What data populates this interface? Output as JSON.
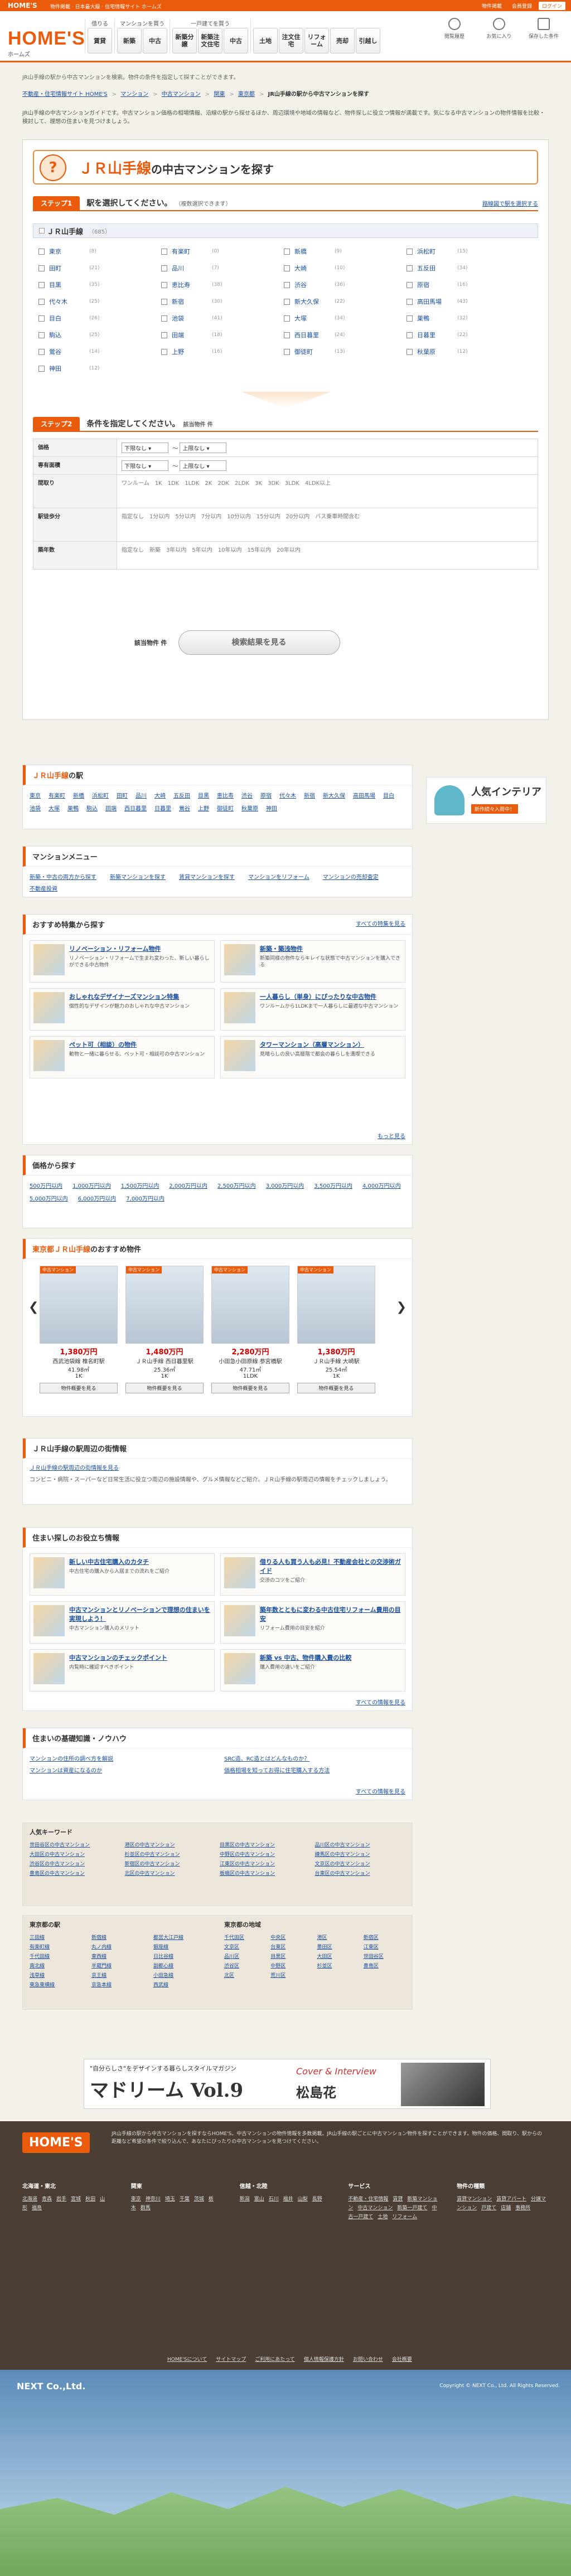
{
  "topbar": {
    "logo": "HOME'S",
    "tagline": "物件掲載 · 日本最大級 · 住宅情報サイト ホームズ",
    "right_links": [
      "物件掲載",
      "会員登録"
    ],
    "login": "ログイン"
  },
  "header": {
    "logo": "HOME'S",
    "logo_sub": "ホームズ",
    "nav_groups": [
      {
        "heading": "借りる",
        "buttons": [
          "賃貸"
        ]
      },
      {
        "heading": "マンションを買う",
        "buttons": [
          "新築",
          "中古"
        ]
      },
      {
        "heading": "一戸建てを買う",
        "buttons": [
          "新築分譲",
          "新築注文住宅",
          "中古"
        ]
      },
      {
        "heading": "",
        "buttons": [
          "土地",
          "注文住宅",
          "リフォーム",
          "売却",
          "引越し"
        ]
      }
    ],
    "icons": [
      {
        "icon": "history-icon",
        "label": "閲覧履歴"
      },
      {
        "icon": "star-icon",
        "label": "お気に入り"
      },
      {
        "icon": "document-icon",
        "label": "保存した条件"
      }
    ]
  },
  "breadcrumb_note": "JR山手線の駅から中古マンションを検索。物件の条件を指定して探すことができます。",
  "crumbs": [
    "不動産・住宅情報サイト HOME'S",
    "マンション",
    "中古マンション",
    "関東",
    "東京都",
    "JR山手線の駅から中古マンションを探す"
  ],
  "intro": "JR山手線の中古マンションガイドです。中古マンション価格の相場情報、沿線の駅から探せるほか、周辺環境や地域の情報など、物件探しに役立つ情報が満載です。気になる中古マンションの物件情報を比較・検討して、理想の住まいを見つけましょう。",
  "search": {
    "title": "ＪＲ山手線",
    "title_suffix": "の中古マンションを探す",
    "title_icon": "?",
    "step1_badge": "ステップ1",
    "step1_text": "駅を選択してください。",
    "step1_note": "（複数選択できます）",
    "step1_link": "路線図で駅を選択する",
    "line_name": "ＪＲ山手線",
    "line_count": "（685）",
    "stations": [
      {
        "name": "東京",
        "count": "(8)"
      },
      {
        "name": "有楽町",
        "count": "(0)"
      },
      {
        "name": "新橋",
        "count": "(9)"
      },
      {
        "name": "浜松町",
        "count": "(15)"
      },
      {
        "name": "田町",
        "count": "(21)"
      },
      {
        "name": "品川",
        "count": "(7)"
      },
      {
        "name": "大崎",
        "count": "(10)"
      },
      {
        "name": "五反田",
        "count": "(34)"
      },
      {
        "name": "目黒",
        "count": "(35)"
      },
      {
        "name": "恵比寿",
        "count": "(38)"
      },
      {
        "name": "渋谷",
        "count": "(36)"
      },
      {
        "name": "原宿",
        "count": "(16)"
      },
      {
        "name": "代々木",
        "count": "(25)"
      },
      {
        "name": "新宿",
        "count": "(30)"
      },
      {
        "name": "新大久保",
        "count": "(22)"
      },
      {
        "name": "高田馬場",
        "count": "(43)"
      },
      {
        "name": "目白",
        "count": "(26)"
      },
      {
        "name": "池袋",
        "count": "(41)"
      },
      {
        "name": "大塚",
        "count": "(34)"
      },
      {
        "name": "巣鴨",
        "count": "(32)"
      },
      {
        "name": "駒込",
        "count": "(25)"
      },
      {
        "name": "田端",
        "count": "(18)"
      },
      {
        "name": "西日暮里",
        "count": "(24)"
      },
      {
        "name": "日暮里",
        "count": "(22)"
      },
      {
        "name": "鶯谷",
        "count": "(14)"
      },
      {
        "name": "上野",
        "count": "(16)"
      },
      {
        "name": "御徒町",
        "count": "(13)"
      },
      {
        "name": "秋葉原",
        "count": "(12)"
      },
      {
        "name": "神田",
        "count": "(12)"
      }
    ],
    "step2_badge": "ステップ2",
    "step2_text": "条件を指定してください。",
    "step2_count_label": "該当物件",
    "step2_count_unit": "件",
    "conditions": [
      {
        "label": "価格",
        "content": "下限なし ～ 上限なし"
      },
      {
        "label": "専有面積",
        "content": "下限なし ～ 上限なし　※「以上」は「未満」と同じです"
      },
      {
        "label": "間取り",
        "content": "ワンルーム　1K　1DK　1LDK　2K　2DK　2LDK　3K　3DK　3LDK　4LDK以上"
      },
      {
        "label": "駅徒歩分",
        "content": "指定なし　1分以内　5分以内　7分以内　10分以内　15分以内　20分以内　バス乗車時間含む"
      },
      {
        "label": "築年数",
        "content": "指定なし　新築　3年以内　5年以内　10年以内　15年以内　20年以内"
      }
    ],
    "result_label": "該当物件",
    "result_unit": "件",
    "result_button": "検索結果を見る"
  },
  "eki": {
    "title_red": "ＪＲ山手線",
    "title_rest": "の駅",
    "stations": [
      "東京",
      "有楽町",
      "新橋",
      "浜松町",
      "田町",
      "品川",
      "大崎",
      "五反田",
      "目黒",
      "恵比寿",
      "渋谷",
      "原宿",
      "代々木",
      "新宿",
      "新大久保",
      "高田馬場",
      "目白",
      "池袋",
      "大塚",
      "巣鴨",
      "駒込",
      "田端",
      "西日暮里",
      "日暮里",
      "鶯谷",
      "上野",
      "御徒町",
      "秋葉原",
      "神田"
    ]
  },
  "menu": {
    "title": "マンションメニュー",
    "links": [
      "新築・中古の両方から探す",
      "新築マンションを探す",
      "賃貸マンションを探す",
      "マンションをリフォーム",
      "マンションの売却査定",
      "不動産投資"
    ]
  },
  "features": {
    "title": "おすすめ特集から探す",
    "more": "すべての特集を見る",
    "items": [
      {
        "title": "リノベーション・リフォーム物件",
        "desc": "リノベーション・リフォームで生まれ変わった、新しい暮らしができる中古物件"
      },
      {
        "title": "新築・築浅物件",
        "desc": "新築同様の物件ならキレイな状態で中古マンションを購入できる"
      },
      {
        "title": "おしゃれなデザイナーズマンション特集",
        "desc": "個性的なデザインが魅力のおしゃれな中古マンション"
      },
      {
        "title": "一人暮らし（単身）にぴったりな中古物件",
        "desc": "ワンルームから1LDKまで一人暮らしに最適な中古マンション"
      },
      {
        "title": "ペット可（相談）の物件",
        "desc": "動物と一緒に暮らせる、ペット可・相談可の中古マンション"
      },
      {
        "title": "タワーマンション（高層マンション）",
        "desc": "見晴らしの良い高層階で都会の暮らしを満喫できる"
      }
    ],
    "more2": "もっと見る"
  },
  "prices": {
    "title": "価格から探す",
    "items": [
      "500万円以内",
      "1,000万円以内",
      "1,500万円以内",
      "2,000万円以内",
      "2,500万円以内",
      "3,000万円以内",
      "3,500万円以内",
      "4,000万円以内",
      "5,000万円以内",
      "6,000万円以内",
      "7,000万円以内"
    ]
  },
  "recommend": {
    "title_red": "東京都ＪＲ山手線",
    "title_rest": "のおすすめ物件",
    "items": [
      {
        "label": "中古マンション",
        "price": "1,380万円",
        "name": "西武池袋線 椎名町駅",
        "spec": "41.98㎡",
        "sub": "1K",
        "btn": "物件概要を見る"
      },
      {
        "label": "中古マンション",
        "price": "1,480万円",
        "name": "ＪＲ山手線 西日暮里駅",
        "spec": "25.36㎡",
        "sub": "1K",
        "btn": "物件概要を見る"
      },
      {
        "label": "中古マンション",
        "price": "2,280万円",
        "name": "小田急小田原線 参宮橋駅",
        "spec": "47.71㎡",
        "sub": "1LDK",
        "btn": "物件概要を見る"
      },
      {
        "label": "中古マンション",
        "price": "1,380万円",
        "name": "ＪＲ山手線 大崎駅",
        "spec": "25.54㎡",
        "sub": "1K",
        "btn": "物件概要を見る"
      }
    ]
  },
  "neighborhood": {
    "title": "ＪＲ山手線の駅周辺の街情報",
    "link": "ＪＲ山手線の駅周辺の街情報を見る",
    "desc": "コンビニ・病院・スーパーなど日常生活に役立つ周辺の施設情報や、グルメ情報などご紹介。ＪＲ山手線の駅周辺の情報をチェックしましょう。"
  },
  "tips": {
    "title": "住まい探しのお役立ち情報",
    "items": [
      {
        "title": "新しい中古住宅購入のカタチ",
        "desc": "中古住宅の購入から入居までの流れをご紹介"
      },
      {
        "title": "借りる人も買う人も必見！不動産会社との交渉術ガイド",
        "desc": "交渉のコツをご紹介"
      },
      {
        "title": "中古マンションとリノベーションで理想の住まいを実現しよう！",
        "desc": "中古マンション購入のメリット"
      },
      {
        "title": "築年数とともに変わる中古住宅リフォーム費用の目安",
        "desc": "リフォーム費用の目安を紹介"
      },
      {
        "title": "中古マンションのチェックポイント",
        "desc": "内覧時に確認すべきポイント"
      },
      {
        "title": "新築 vs 中古、物件購入費の比較",
        "desc": "購入費用の違いをご紹介"
      }
    ],
    "more": "すべての情報を見る"
  },
  "knowhow": {
    "title": "住まいの基礎知識・ノウハウ",
    "items": [
      "マンションの住所の調べ方を解説",
      "SRC造、RC造とはどんなものか？",
      "マンションは資産になるのか",
      "価格相場を知ってお得に住宅購入する方法"
    ],
    "more": "すべての情報を見る"
  },
  "keywords": {
    "title": "人気キーワード",
    "items": [
      "世田谷区の中古マンション",
      "港区の中古マンション",
      "目黒区の中古マンション",
      "品川区の中古マンション",
      "大田区の中古マンション",
      "杉並区の中古マンション",
      "中野区の中古マンション",
      "練馬区の中古マンション",
      "渋谷区の中古マンション",
      "新宿区の中古マンション",
      "江東区の中古マンション",
      "文京区の中古マンション",
      "豊島区の中古マンション",
      "北区の中古マンション",
      "板橋区の中古マンション",
      "台東区の中古マンション"
    ]
  },
  "regions": {
    "t1": "東京都の駅",
    "l1": [
      "三田線",
      "新宿線",
      "都営大江戸線",
      "有楽町線",
      "丸ノ内線",
      "銀座線",
      "千代田線",
      "東西線",
      "日比谷線",
      "南北線",
      "半蔵門線",
      "副都心線",
      "浅草線",
      "京王線",
      "小田急線",
      "東急東横線",
      "京急本線",
      "西武線"
    ],
    "t2": "東京都の地域",
    "l2": [
      "千代田区",
      "中央区",
      "港区",
      "新宿区",
      "文京区",
      "台東区",
      "墨田区",
      "江東区",
      "品川区",
      "目黒区",
      "大田区",
      "世田谷区",
      "渋谷区",
      "中野区",
      "杉並区",
      "豊島区",
      "北区",
      "荒川区"
    ]
  },
  "sidead": {
    "title": "人気インテリア",
    "sub": "新作続々入荷中！"
  },
  "banner": {
    "lead": "\"自分らしさ\"をデザインする暮らしスタイルマガジン",
    "mag": "マドリーム Vol.9",
    "cover": "Cover & Interview",
    "person": "松島花"
  },
  "footer": {
    "logo": "HOME'S",
    "desc": "JR山手線の駅から中古マンションを探すならHOME'S。中古マンションの物件情報を多数掲載。JR山手線の駅ごとに中古マンション物件を探すことができます。物件の価格、間取り、駅からの距離など希望の条件で絞り込んで、あなたにぴったりの中古マンションを見つけてください。",
    "cols": [
      {
        "h": "北海道・東北",
        "links": [
          "北海道",
          "青森",
          "岩手",
          "宮城",
          "秋田",
          "山形",
          "福島"
        ]
      },
      {
        "h": "関東",
        "links": [
          "東京",
          "神奈川",
          "埼玉",
          "千葉",
          "茨城",
          "栃木",
          "群馬"
        ]
      },
      {
        "h": "信越・北陸",
        "links": [
          "新潟",
          "富山",
          "石川",
          "福井",
          "山梨",
          "長野"
        ]
      },
      {
        "h": "サービス",
        "links": [
          "不動産・住宅情報",
          "賃貸",
          "新築マンション",
          "中古マンション",
          "新築一戸建て",
          "中古一戸建て",
          "土地",
          "リフォーム"
        ]
      },
      {
        "h": "物件の種類",
        "links": [
          "賃貸マンション",
          "賃貸アパート",
          "分譲マンション",
          "戸建て",
          "店舗",
          "事務所"
        ]
      }
    ],
    "links": [
      "HOME'Sについて",
      "サイトマップ",
      "ご利用にあたって",
      "個人情報保護方針",
      "お問い合わせ",
      "会社概要"
    ],
    "company": "NEXT Co.,Ltd.",
    "copyright": "Copyright © NEXT Co., Ltd. All Rights Reserved."
  }
}
